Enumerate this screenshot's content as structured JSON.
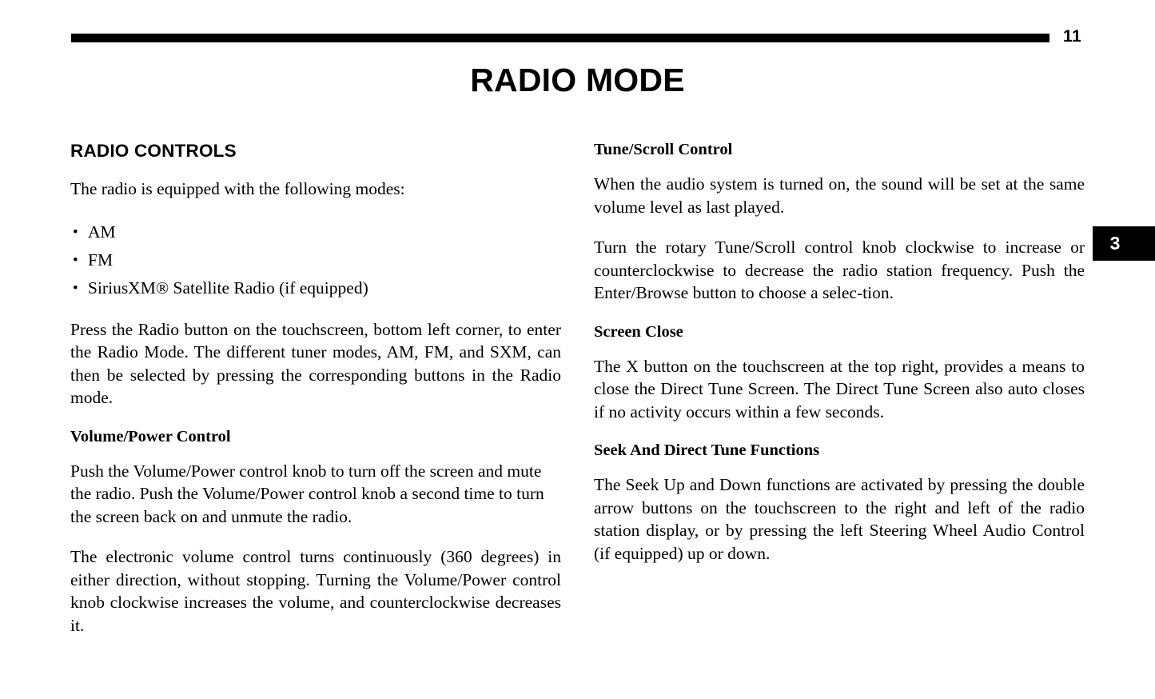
{
  "header": {
    "page_number": "11",
    "rule": "horizontal-rule"
  },
  "title": "RADIO MODE",
  "chapter_tab": {
    "number": "3"
  },
  "left_column": {
    "section_heading": "RADIO CONTROLS",
    "intro": "The radio is equipped with the following modes:",
    "bullet_glyph": "•",
    "modes": [
      "AM",
      "FM",
      "SiriusXM® Satellite Radio (if equipped)"
    ],
    "paragraph_radio_button": "Press the Radio button on the touchscreen, bottom left corner, to enter the Radio Mode. The different tuner modes, AM, FM, and SXM, can then be selected by pressing the corresponding buttons in the Radio mode.",
    "heading_volume_power": "Volume/Power Control",
    "paragraph_volume_push": "Push the Volume/Power control knob to turn off the screen and mute the radio. Push the Volume/Power control knob a second time to turn the screen back on and unmute the radio.",
    "paragraph_volume_electronic": "The electronic volume control turns continuously (360 degrees) in either direction, without stopping. Turning the Volume/Power control knob clockwise increases the volume, and counterclockwise decreases it."
  },
  "right_column": {
    "heading_tune_scroll": "Tune/Scroll Control",
    "paragraph_audio_on": "When the audio system is turned on, the sound will be set at the same volume level as last played.",
    "paragraph_rotary": "Turn the rotary Tune/Scroll control knob clockwise to increase or counterclockwise to decrease the radio station frequency. Push the Enter/Browse button to choose a selec-tion.",
    "heading_screen_close": "Screen Close",
    "paragraph_x_button": "The X button on the touchscreen at the top right, provides a means to close the Direct Tune Screen. The Direct Tune Screen also auto closes if no activity occurs within a few seconds.",
    "heading_seek_direct_tune": "Seek And Direct Tune Functions",
    "paragraph_seek": "The Seek Up and Down functions are activated by pressing the double arrow buttons on the touchscreen to the right and left of the radio station display, or by pressing the left Steering Wheel Audio Control (if equipped) up or down."
  }
}
